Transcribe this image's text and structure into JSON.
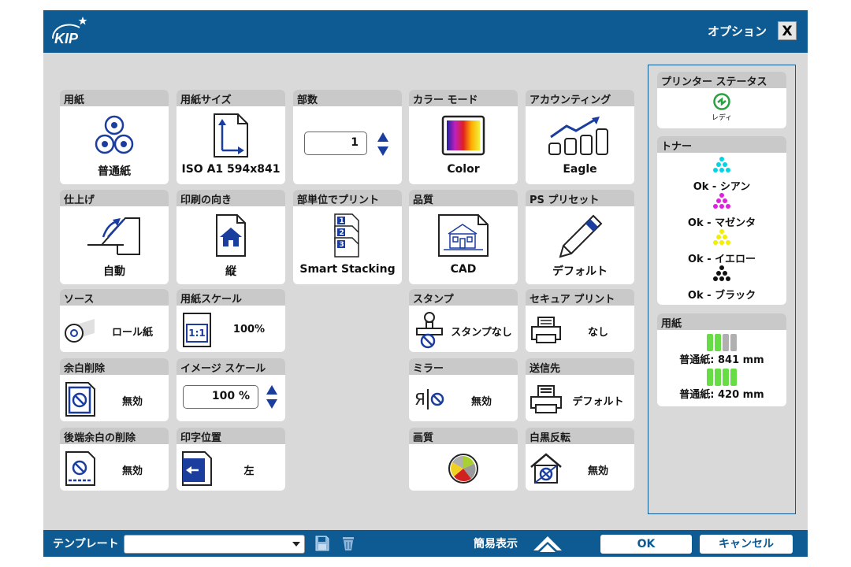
{
  "window": {
    "title": "オプション",
    "close_label": "X",
    "logo_text": "KIP"
  },
  "tiles": {
    "paper": {
      "header": "用紙",
      "caption": "普通紙"
    },
    "paper_size": {
      "header": "用紙サイズ",
      "caption": "ISO A1 594x841"
    },
    "copies": {
      "header": "部数",
      "value": "1"
    },
    "color_mode": {
      "header": "カラー モード",
      "caption": "Color"
    },
    "accounting": {
      "header": "アカウンティング",
      "caption": "Eagle"
    },
    "finishing": {
      "header": "仕上げ",
      "caption": "自動"
    },
    "orientation": {
      "header": "印刷の向き",
      "caption": "縦"
    },
    "collate": {
      "header": "部単位でプリント",
      "caption": "Smart Stacking"
    },
    "quality": {
      "header": "品質",
      "caption": "CAD"
    },
    "ps_preset": {
      "header": "PS プリセット",
      "caption": "デフォルト"
    },
    "source": {
      "header": "ソース",
      "value": "ロール紙"
    },
    "paper_scale": {
      "header": "用紙スケール",
      "value": "100%",
      "icon_text": "1:1"
    },
    "stamp": {
      "header": "スタンプ",
      "value": "スタンプなし"
    },
    "secure_print": {
      "header": "セキュア プリント",
      "value": "なし"
    },
    "margin_removal": {
      "header": "余白削除",
      "value": "無効"
    },
    "image_scale": {
      "header": "イメージ スケール",
      "value": "100 %"
    },
    "mirror": {
      "header": "ミラー",
      "value": "無効",
      "icon_text": "Я"
    },
    "destination": {
      "header": "送信先",
      "value": "デフォルト"
    },
    "trailing_margin": {
      "header": "後端余白の削除",
      "value": "無効"
    },
    "print_position": {
      "header": "印字位置",
      "value": "左"
    },
    "image_quality": {
      "header": "画質"
    },
    "invert": {
      "header": "白黒反転",
      "value": "無効"
    }
  },
  "status": {
    "printer": {
      "header": "プリンター ステータス",
      "state": "レディ"
    },
    "toner": {
      "header": "トナー",
      "items": [
        {
          "label": "Ok - シアン",
          "color": "#00d4e6"
        },
        {
          "label": "Ok - マゼンタ",
          "color": "#e020e0"
        },
        {
          "label": "Ok - イエロー",
          "color": "#f0f000"
        },
        {
          "label": "Ok - ブラック",
          "color": "#111111"
        }
      ]
    },
    "paper": {
      "header": "用紙",
      "rolls": [
        {
          "label": "普通紙: 841 mm",
          "loaded": [
            true,
            true,
            false,
            false
          ]
        },
        {
          "label": "普通紙: 420 mm",
          "loaded": [
            true,
            true,
            true,
            true
          ]
        }
      ]
    }
  },
  "bottom": {
    "template_label": "テンプレート",
    "template_value": "",
    "simple_view_label": "簡易表示",
    "ok_label": "OK",
    "cancel_label": "キャンセル"
  },
  "colors": {
    "brand": "#0d5b92",
    "icon_blue": "#1a3d9e",
    "roll_green": "#66dd44",
    "roll_gray": "#b0b0b0"
  }
}
